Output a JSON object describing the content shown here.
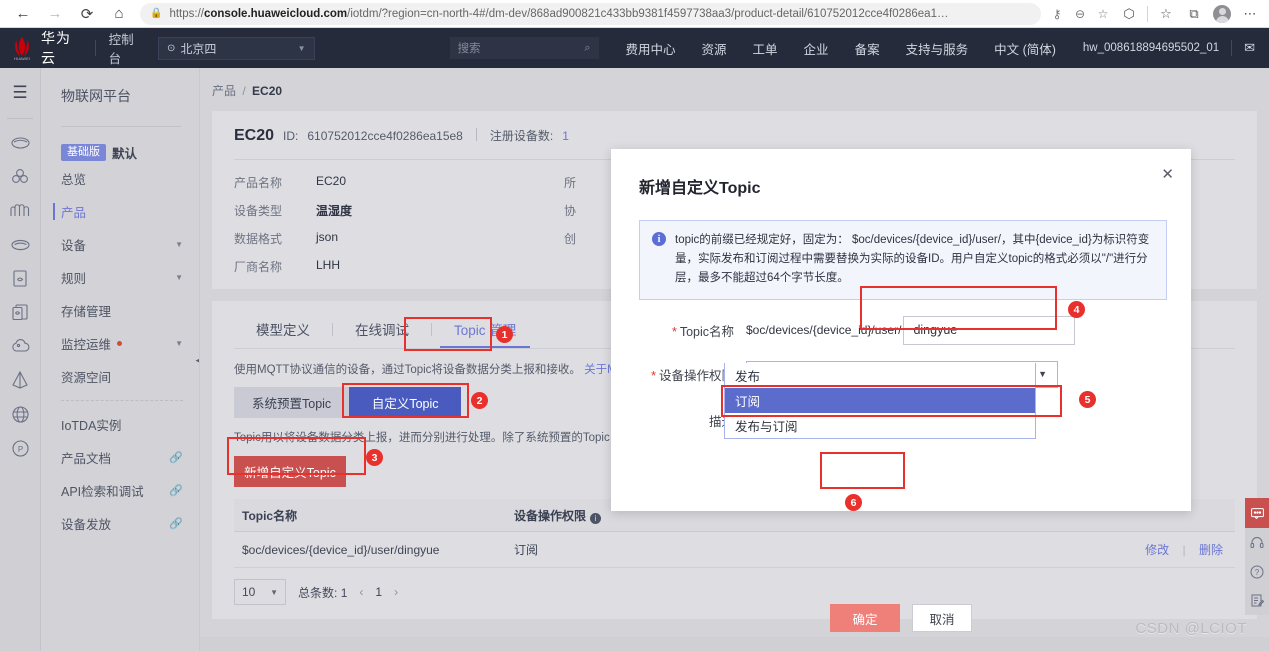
{
  "browser": {
    "back_icon": "←",
    "forward_icon": "→",
    "reload_icon": "⟳",
    "home_icon": "⌂",
    "lock_icon": "🔒",
    "url_prefix": "https://",
    "url_host": "console.huaweicloud.com",
    "url_path": "/iotdm/?region=cn-north-4#/dm-dev/868ad900821c433bb9381f4597738aa3/product-detail/610752012cce4f0286ea1…",
    "key_icon": "⚷",
    "zoomout_icon": "⊖",
    "favorite_icon": "☆",
    "split_icon": "⬡",
    "collections_icon": "☆",
    "tabgroups_icon": "⧉",
    "profile_icon": "avatar",
    "more_icon": "⋯"
  },
  "topnav": {
    "brand": "华为云",
    "console": "控制台",
    "region": "北京四",
    "region_pin": "⊙",
    "region_caret": "▼",
    "search_placeholder": "搜索",
    "search_icon": "⌕",
    "menu": [
      "费用中心",
      "资源",
      "工单",
      "企业",
      "备案",
      "支持与服务",
      "中文 (简体)"
    ],
    "user": "hw_008618894695502_01",
    "mail_icon": "✉"
  },
  "rail": {
    "menu_icon": "☰",
    "icons": [
      "cloud-icon",
      "cluster-icon",
      "wave-icon",
      "disk-icon",
      "document-icon",
      "copy-icon",
      "cloud-up-icon",
      "pyramid-icon",
      "globe-icon",
      "p-circle-icon"
    ]
  },
  "sidebar": {
    "title": "物联网平台",
    "version_badge": "基础版",
    "version_name": "默认",
    "items": [
      {
        "label": "总览",
        "active": false,
        "arrow": "",
        "dot": false,
        "link": false
      },
      {
        "label": "产品",
        "active": true,
        "arrow": "",
        "dot": false,
        "link": false
      },
      {
        "label": "设备",
        "active": false,
        "arrow": "▼",
        "dot": false,
        "link": false
      },
      {
        "label": "规则",
        "active": false,
        "arrow": "▼",
        "dot": false,
        "link": false
      },
      {
        "label": "存储管理",
        "active": false,
        "arrow": "",
        "dot": false,
        "link": false
      },
      {
        "label": "监控运维",
        "active": false,
        "arrow": "▼",
        "dot": true,
        "link": false
      },
      {
        "label": "资源空间",
        "active": false,
        "arrow": "",
        "dot": false,
        "link": false
      }
    ],
    "items2": [
      {
        "label": "IoTDA实例",
        "link": false
      },
      {
        "label": "产品文档",
        "link": true
      },
      {
        "label": "API检索和调试",
        "link": true
      },
      {
        "label": "设备发放",
        "link": true
      }
    ],
    "link_icon": "🔗",
    "collapse_icon": "◀"
  },
  "breadcrumb": {
    "parent": "产品",
    "sep": "/",
    "current": "EC20"
  },
  "product": {
    "name": "EC20",
    "id_label": "ID:",
    "id_value": "610752012cce4f0286ea15e8",
    "device_count_label": "注册设备数:",
    "device_count_value": "1",
    "fields": [
      {
        "key": "产品名称",
        "value": "EC20",
        "bold": false
      },
      {
        "key": "设备类型",
        "value": "温湿度",
        "bold": true
      },
      {
        "key": "数据格式",
        "value": "json",
        "bold": false
      },
      {
        "key": "厂商名称",
        "value": "LHH",
        "bold": false
      }
    ],
    "fields_right": [
      "所",
      "协",
      "创"
    ]
  },
  "tabs": [
    {
      "label": "模型定义",
      "active": false
    },
    {
      "label": "在线调试",
      "active": false
    },
    {
      "label": "Topic 管理",
      "active": true
    }
  ],
  "topic_panel": {
    "desc1": "使用MQTT协议通信的设备，通过Topic将设备数据分类上报和接收。",
    "desc1_link": "关于MQTT消息传",
    "segments": [
      {
        "label": "系统预置Topic",
        "selected": false
      },
      {
        "label": "自定义Topic",
        "selected": true
      }
    ],
    "desc2": "Topic用以将设备数据分类上报，进而分别进行处理。除了系统预置的Topic，您也可以",
    "add_button": "新增自定义Topic",
    "table": {
      "columns": [
        "Topic名称",
        "设备操作权限"
      ],
      "col_info_icon": "i",
      "rows": [
        {
          "topic": "$oc/devices/{device_id}/user/dingyue",
          "perm": "订阅",
          "edit": "修改",
          "delete": "删除"
        }
      ]
    },
    "pager": {
      "page_size": "10",
      "caret": "▼",
      "total_label": "总条数:",
      "total_value": "1",
      "prev": "‹",
      "current": "1",
      "next": "›"
    }
  },
  "modal": {
    "title": "新增自定义Topic",
    "close_icon": "✕",
    "alert_icon": "i",
    "alert_text": "topic的前缀已经规定好，固定为： $oc/devices/{device_id}/user/，其中{device_id}为标识符变量，实际发布和订阅过程中需要替换为实际的设备ID。用户自定义topic的格式必须以\"/\"进行分层，最多不能超过64个字节长度。",
    "topic_label": "Topic名称",
    "topic_prefix": "$oc/devices/{device_id}/user/",
    "topic_value": "dingyue",
    "perm_label": "设备操作权限",
    "perm_value": "订阅",
    "perm_caret": "▼",
    "perm_options": [
      {
        "label": "发布",
        "selected": false
      },
      {
        "label": "订阅",
        "selected": true
      },
      {
        "label": "发布与订阅",
        "selected": false
      }
    ],
    "desc_label": "描述",
    "ok_button": "确定",
    "cancel_button": "取消"
  },
  "annotations": [
    {
      "number": "1"
    },
    {
      "number": "2"
    },
    {
      "number": "3"
    },
    {
      "number": "4"
    },
    {
      "number": "5"
    },
    {
      "number": "6"
    }
  ],
  "float_toolbar": {
    "chat_icon": "💬",
    "icons": [
      "headset-icon",
      "help-icon",
      "feedback-icon"
    ]
  },
  "watermark": "CSDN @LCIOT",
  "colors": {
    "accent_blue": "#6b76d4",
    "select_blue": "#5b6ccc",
    "seg_blue": "#4a5bbf",
    "annotation_red": "#e8312c",
    "button_red": "#c8504f",
    "ok_red": "#ef8079",
    "topnav_bg": "#252b3a"
  }
}
